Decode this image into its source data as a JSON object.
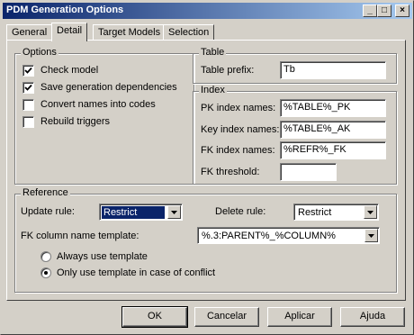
{
  "window": {
    "title": "PDM Generation Options"
  },
  "titlebar_buttons": {
    "minimize": "_",
    "maximize": "□",
    "close": "×"
  },
  "tabs": [
    {
      "label": "General",
      "active": false
    },
    {
      "label": "Detail",
      "active": true
    },
    {
      "label": "Target Models",
      "active": false
    },
    {
      "label": "Selection",
      "active": false
    }
  ],
  "options": {
    "title": "Options",
    "items": [
      {
        "label": "Check model",
        "checked": true
      },
      {
        "label": "Save generation dependencies",
        "checked": true
      },
      {
        "label": "Convert names into codes",
        "checked": false
      },
      {
        "label": "Rebuild triggers",
        "checked": false
      }
    ]
  },
  "table": {
    "title": "Table",
    "prefix_label": "Table prefix:",
    "prefix_value": "Tb"
  },
  "index": {
    "title": "Index",
    "pk_label": "PK index names:",
    "pk_value": "%TABLE%_PK",
    "key_label": "Key index names:",
    "key_value": "%TABLE%_AK",
    "fk_label": "FK index names:",
    "fk_value": "%REFR%_FK",
    "threshold_label": "FK threshold:",
    "threshold_value": ""
  },
  "reference": {
    "title": "Reference",
    "update_label": "Update rule:",
    "update_value": "Restrict",
    "delete_label": "Delete rule:",
    "delete_value": "Restrict",
    "fk_template_label": "FK column name template:",
    "fk_template_value": "%.3:PARENT%_%COLUMN%",
    "radio_always": "Always use template",
    "radio_conflict": "Only use template in case of conflict",
    "selected_radio": "conflict"
  },
  "buttons": {
    "ok": "OK",
    "cancel": "Cancelar",
    "apply": "Aplicar",
    "help": "Ajuda"
  },
  "colors": {
    "face": "#d4d0c8",
    "title_gradient_start": "#0a246a",
    "title_gradient_end": "#a6caf0",
    "selection": "#0a246a"
  }
}
